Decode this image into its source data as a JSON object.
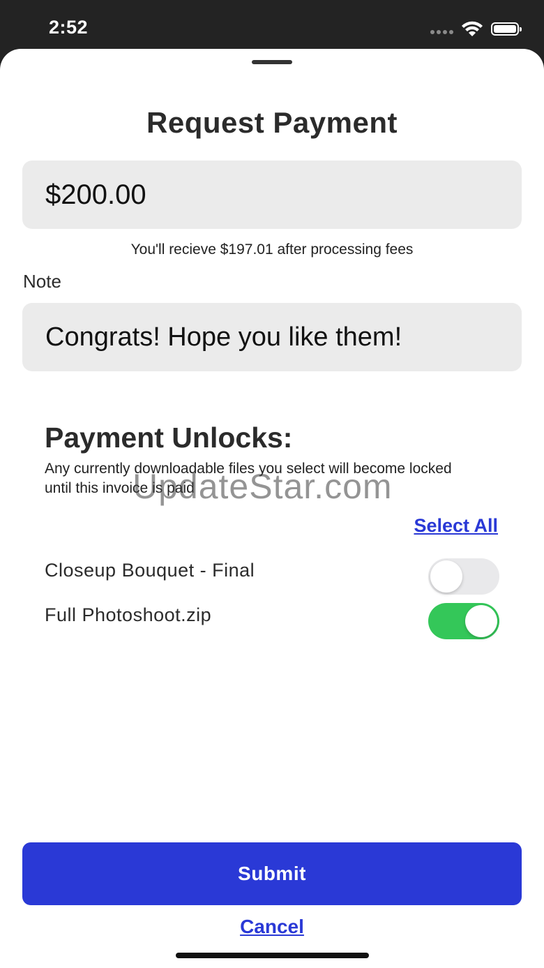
{
  "status_bar": {
    "time": "2:52",
    "icons": [
      "signal-dots-icon",
      "wifi-icon",
      "battery-icon"
    ]
  },
  "sheet": {
    "title": "Request Payment",
    "amount_value": "$200.00",
    "fees_text": "You'll recieve $197.01 after processing fees",
    "note_label": "Note",
    "note_value": "Congrats! Hope you like them!",
    "unlocks_title": "Payment Unlocks:",
    "unlocks_description": "Any currently downloadable files you select will become locked until this invoice is paid",
    "select_all_label": "Select All",
    "files": [
      {
        "name": "Closeup Bouquet - Final",
        "locked": false
      },
      {
        "name": "Full Photoshoot.zip",
        "locked": true
      }
    ],
    "submit_label": "Submit",
    "cancel_label": "Cancel"
  },
  "watermark": "UpdateStar.com",
  "colors": {
    "accent": "#2a39d6",
    "toggle_on": "#34c759",
    "toggle_off": "#e9e9eb",
    "field_bg": "#ebebeb"
  }
}
